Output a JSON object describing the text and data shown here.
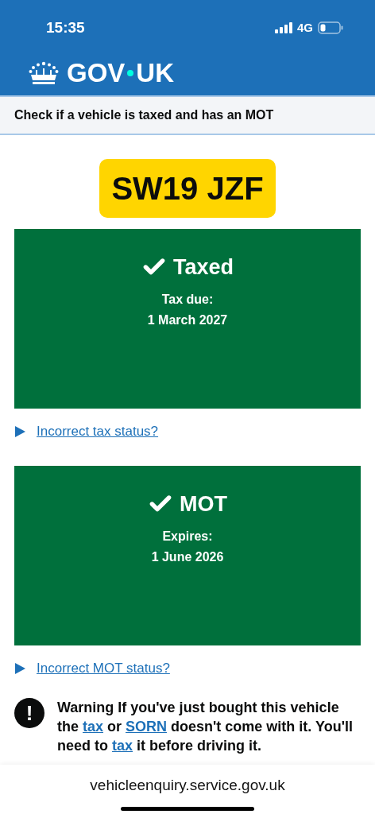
{
  "status_bar": {
    "time": "15:35",
    "network": "4G"
  },
  "header": {
    "logo_left": "GOV",
    "logo_right": "UK"
  },
  "service_name": "Check if a vehicle is taxed and has an MOT",
  "registration": "SW19 JZF",
  "statuses": [
    {
      "title": "Taxed",
      "detail_label": "Tax due:",
      "detail_value": "1 March 2027",
      "valid": true,
      "link": "Incorrect tax status?"
    },
    {
      "title": "MOT",
      "detail_label": "Expires:",
      "detail_value": "1 June 2026",
      "valid": true,
      "link": "Incorrect MOT status?"
    }
  ],
  "warning": {
    "icon": "!",
    "segments": [
      {
        "text": "Warning If you've just bought this vehicle the ",
        "link": false
      },
      {
        "text": "tax",
        "link": true
      },
      {
        "text": " or ",
        "link": false
      },
      {
        "text": "SORN",
        "link": true
      },
      {
        "text": " doesn't come with it. You'll need to ",
        "link": false
      },
      {
        "text": "tax",
        "link": true
      },
      {
        "text": " it before driving it.",
        "link": false
      }
    ]
  },
  "address_bar": {
    "url": "vehicleenquiry.service.gov.uk"
  }
}
